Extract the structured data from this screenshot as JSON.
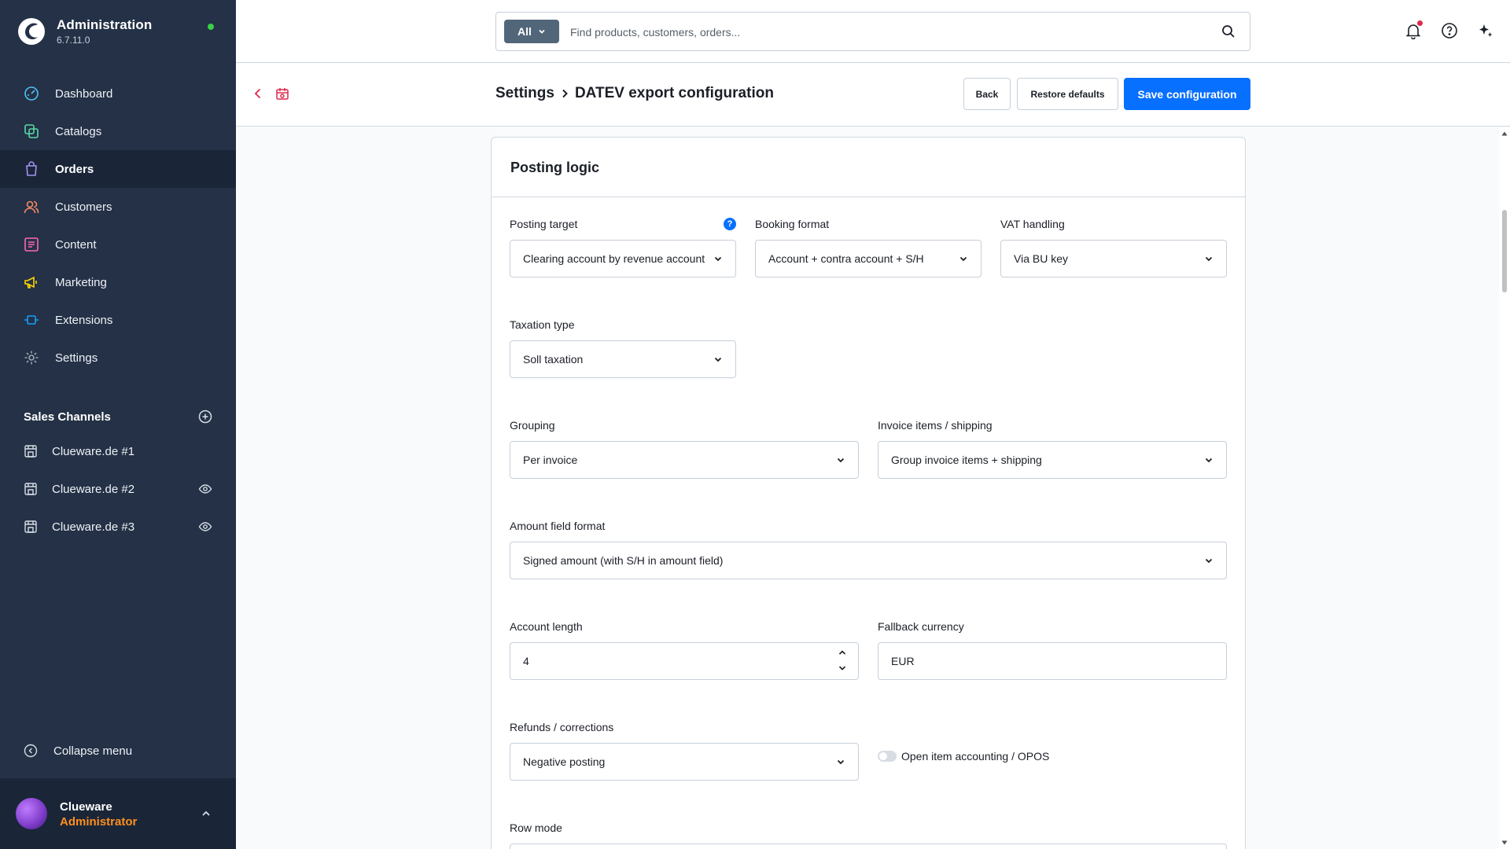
{
  "app": {
    "title": "Administration",
    "version": "6.7.11.0"
  },
  "sidebar": {
    "items": [
      {
        "label": "Dashboard",
        "icon": "dashboard-icon",
        "color": "#4fc3f7"
      },
      {
        "label": "Catalogs",
        "icon": "catalogs-icon",
        "color": "#57d9a3"
      },
      {
        "label": "Orders",
        "icon": "orders-icon",
        "color": "#a092f0",
        "active": true
      },
      {
        "label": "Customers",
        "icon": "customers-icon",
        "color": "#f88962"
      },
      {
        "label": "Content",
        "icon": "content-icon",
        "color": "#ff68b4"
      },
      {
        "label": "Marketing",
        "icon": "marketing-icon",
        "color": "#ffd700"
      },
      {
        "label": "Extensions",
        "icon": "extensions-icon",
        "color": "#189eff"
      },
      {
        "label": "Settings",
        "icon": "settings-icon",
        "color": "#9aa8b5"
      }
    ],
    "sales_channels": {
      "title": "Sales Channels",
      "items": [
        {
          "label": "Clueware.de #1",
          "visible_icon": false
        },
        {
          "label": "Clueware.de #2",
          "visible_icon": true
        },
        {
          "label": "Clueware.de #3",
          "visible_icon": true
        }
      ]
    },
    "collapse_label": "Collapse menu",
    "user": {
      "name": "Clueware",
      "role": "Administrator"
    }
  },
  "search": {
    "scope": "All",
    "placeholder": "Find products, customers, orders..."
  },
  "smartbar": {
    "breadcrumb_parent": "Settings",
    "breadcrumb_current": "DATEV export configuration",
    "back_label": "Back",
    "restore_label": "Restore defaults",
    "save_label": "Save configuration"
  },
  "card": {
    "title": "Posting logic",
    "fields": {
      "posting_target": {
        "label": "Posting target",
        "value": "Clearing account by revenue account"
      },
      "booking_format": {
        "label": "Booking format",
        "value": "Account + contra account + S/H"
      },
      "vat_handling": {
        "label": "VAT handling",
        "value": "Via BU key"
      },
      "taxation_type": {
        "label": "Taxation type",
        "value": "Soll taxation"
      },
      "grouping": {
        "label": "Grouping",
        "value": "Per invoice"
      },
      "invoice_items": {
        "label": "Invoice items / shipping",
        "value": "Group invoice items + shipping"
      },
      "amount_format": {
        "label": "Amount field format",
        "value": "Signed amount (with S/H in amount field)"
      },
      "account_length": {
        "label": "Account length",
        "value": "4"
      },
      "fallback_currency": {
        "label": "Fallback currency",
        "value": "EUR"
      },
      "refunds": {
        "label": "Refunds / corrections",
        "value": "Negative posting"
      },
      "opos": {
        "label": "Open item accounting / OPOS",
        "enabled": false
      },
      "row_mode": {
        "label": "Row mode"
      }
    }
  },
  "colors": {
    "sidebar": "#243146",
    "accent": "#0870ff",
    "user_role": "#ff8f1f",
    "status": "#37d046"
  }
}
